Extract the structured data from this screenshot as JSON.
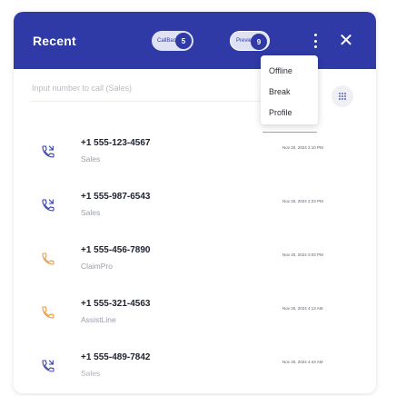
{
  "header": {
    "title": "Recent",
    "callback": {
      "label": "CallBack",
      "count": "5"
    },
    "preview": {
      "label": "Preview",
      "count": "9"
    }
  },
  "search": {
    "placeholder": "Input number to call (Sales)"
  },
  "status_menu": {
    "items": [
      "Offline",
      "Break",
      "Profile"
    ]
  },
  "calls": [
    {
      "number": "+1 555-123-4567",
      "source": "Sales",
      "time": "Nov 20, 2024 2:10 PM",
      "icon": "outgoing-call-icon",
      "color": "#2f3aa6"
    },
    {
      "number": "+1 555-987-6543",
      "source": "Sales",
      "time": "Nov 20, 2024 2:23 PM",
      "icon": "outgoing-call-icon",
      "color": "#2f3aa6"
    },
    {
      "number": "+1 555-456-7890",
      "source": "ClaimPro",
      "time": "Nov 20, 2024 3:03 PM",
      "icon": "incoming-call-icon",
      "color": "#e8963a"
    },
    {
      "number": "+1 555-321-4563",
      "source": "AssistLine",
      "time": "Nov 20, 2024 4:13 AM",
      "icon": "incoming-call-icon",
      "color": "#e8963a"
    },
    {
      "number": "+1 555-489-7842",
      "source": "Sales",
      "time": "Nov 20, 2024 4:43 AM",
      "icon": "outgoing-call-icon",
      "color": "#2f3aa6"
    }
  ],
  "colors": {
    "header": "#2f3aa6",
    "outgoing": "#2f3aa6",
    "incoming": "#e8963a"
  }
}
